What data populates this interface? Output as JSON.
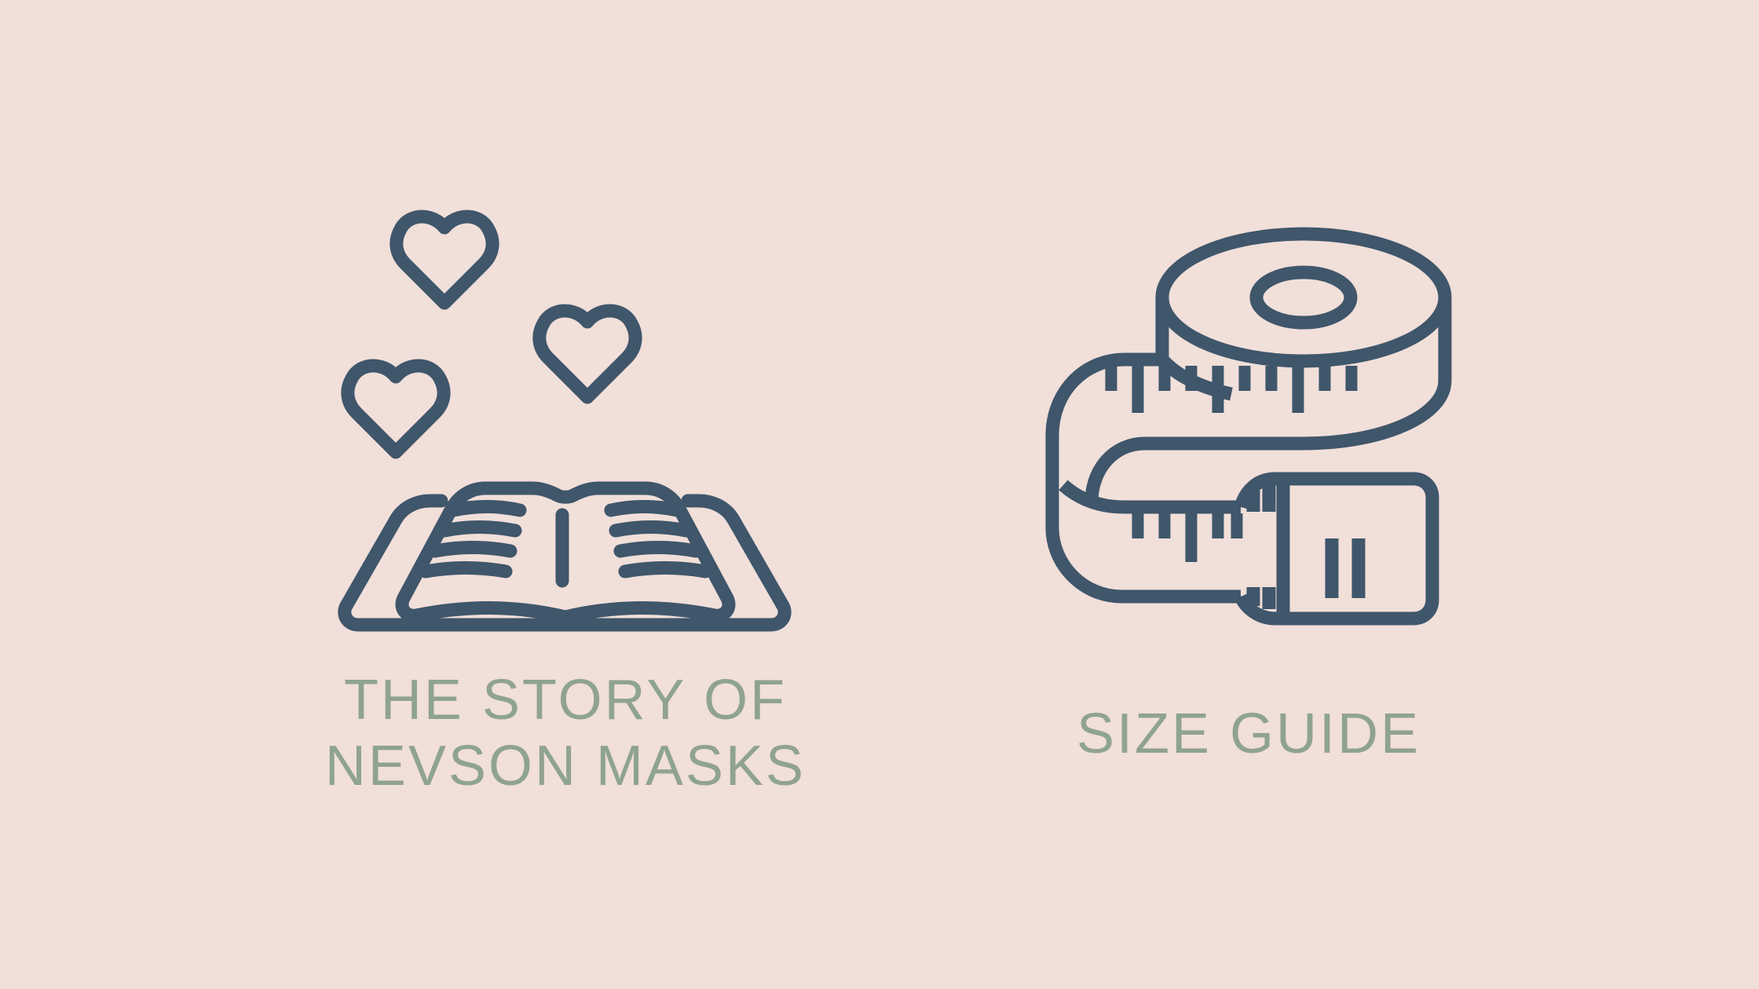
{
  "background_color": "#f1dfd9",
  "icon_color": "#3f566b",
  "label_color": "#8fa391",
  "cards": {
    "story": {
      "icon": "open-book-with-hearts-icon",
      "label_line1": "THE STORY OF",
      "label_line2": "NEVSON MASKS"
    },
    "size": {
      "icon": "measuring-tape-icon",
      "label": "SIZE GUIDE"
    }
  }
}
